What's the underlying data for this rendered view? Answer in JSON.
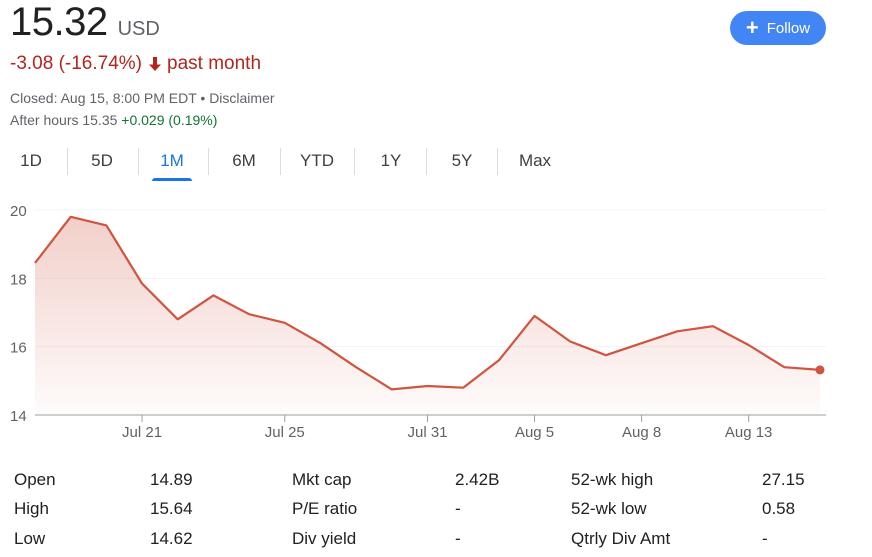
{
  "quote": {
    "price": "15.32",
    "currency": "USD",
    "change": "-3.08 (-16.74%)",
    "period": "past month",
    "closed": "Closed: Aug 15, 8:00 PM EDT • Disclaimer",
    "after_hours_label": "After hours 15.35",
    "after_hours_change": "+0.029 (0.19%)",
    "colors": {
      "negative": "#b3261e",
      "positive": "#137333",
      "accent": "#1a73e8",
      "line": "#d0543f"
    }
  },
  "follow": {
    "label": "Follow",
    "icon": "plus-icon"
  },
  "tabs": [
    {
      "label": "1D",
      "active": false
    },
    {
      "label": "5D",
      "active": false
    },
    {
      "label": "1M",
      "active": true
    },
    {
      "label": "6M",
      "active": false
    },
    {
      "label": "YTD",
      "active": false
    },
    {
      "label": "1Y",
      "active": false
    },
    {
      "label": "5Y",
      "active": false
    },
    {
      "label": "Max",
      "active": false
    }
  ],
  "chart_data": {
    "type": "area",
    "ylim": [
      14,
      20
    ],
    "y_ticks": [
      "20",
      "18",
      "16",
      "14"
    ],
    "x_ticks": [
      "Jul 21",
      "Jul 25",
      "Jul 31",
      "Aug 5",
      "Aug 8",
      "Aug 13"
    ],
    "grid": true,
    "series": [
      {
        "values": [
          18.45,
          19.8,
          19.55,
          17.85,
          16.8,
          17.5,
          16.95,
          16.7,
          16.1,
          15.4,
          14.75,
          14.85,
          14.8,
          15.6,
          16.9,
          16.15,
          15.75,
          16.1,
          16.45,
          16.6,
          16.05,
          15.4,
          15.32
        ]
      }
    ]
  },
  "stats": {
    "col1": [
      {
        "label": "Open",
        "value": "14.89"
      },
      {
        "label": "High",
        "value": "15.64"
      },
      {
        "label": "Low",
        "value": "14.62"
      }
    ],
    "col2": [
      {
        "label": "Mkt cap",
        "value": "2.42B"
      },
      {
        "label": "P/E ratio",
        "value": "-"
      },
      {
        "label": "Div yield",
        "value": "-"
      }
    ],
    "col3": [
      {
        "label": "52-wk high",
        "value": "27.15"
      },
      {
        "label": "52-wk low",
        "value": "0.58"
      },
      {
        "label": "Qtrly Div Amt",
        "value": "-"
      }
    ]
  }
}
